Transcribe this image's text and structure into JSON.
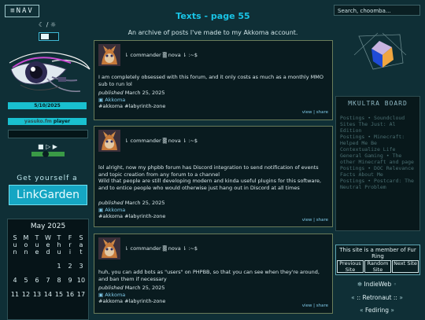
{
  "nav": {
    "label": "≡NAV"
  },
  "theme": {
    "moon": "☾",
    "sep": "/",
    "sun": "☼"
  },
  "sidebar": {
    "date": "5/10/2025",
    "radio_left": "yasuko.fm",
    "radio_right": "player",
    "controls": "■ ▷ ▶",
    "get_yourself": "Get yourself a",
    "linkgarden": "LinkGarden"
  },
  "calendar": {
    "title": "May 2025",
    "day_headers": [
      "S",
      "M",
      "T",
      "W",
      "T",
      "F",
      "S"
    ],
    "day_subs": [
      [
        "u",
        "n"
      ],
      [
        "o",
        "n"
      ],
      [
        "u",
        "e"
      ],
      [
        "e",
        "d"
      ],
      [
        "h",
        "u"
      ],
      [
        "r",
        "i"
      ],
      [
        "a",
        "t"
      ]
    ],
    "weeks": [
      [
        "",
        "",
        "",
        "",
        "1",
        "2",
        "3"
      ],
      [
        "4",
        "5",
        "6",
        "7",
        "8",
        "9",
        "10"
      ],
      [
        "11",
        "12",
        "13",
        "14",
        "15",
        "16",
        "17"
      ]
    ]
  },
  "page": {
    "title": "Texts - page 55",
    "subtitle": "I've made to my Akkoma account."
  },
  "posts": [
    {
      "header": "⇂ commander ▒ nova ⇂ :~$",
      "body": "I am completely obsessed with this forum, and it only costs as much as a monthly MMO sub to run lol",
      "published_label": "published",
      "date": "March 25, 2025",
      "platform": "Akkoma",
      "tags": "#akkoma #labyrinth-zone",
      "view": "view",
      "share": "share"
    },
    {
      "header": "⇂ commander ▒ nova ⇂ :~$",
      "body1": "lol alright, now my phpbb forum has Discord integration to send notification of events and topic creation from any forum to a channel",
      "body2": "Wild that people are still developing modern and kinda useful plugins for this software, and to entice people who would otherwise just hang out in Discord at all times",
      "published_label": "published",
      "date": "March 25, 2025",
      "platform": "Akkoma",
      "tags": "#akkoma #labyrinth-zone",
      "view": "view",
      "share": "share"
    },
    {
      "header": "⇂ commander ▒ nova ⇂ :~$",
      "body": "huh, you can add bots as \"users\" on PHPBB, so that you can see when they're around, and ban them if necessary",
      "published_label": "published",
      "date": "March 25, 2025",
      "platform": "Akkoma",
      "tags": "#akkoma #labyrinth-zone",
      "view": "view",
      "share": "share"
    }
  ],
  "search": {
    "placeholder": "Search, choomba..."
  },
  "mkultra": {
    "title": "MKULTRA BOARD",
    "items": [
      "Postings • Soundcloud Sites The Just: Al Edition",
      "Postings • Minecraft: Helped Me Be Contextualize Life",
      "General Gaming • The other Minecraft and page",
      "Postings • DOC Relevance Facts About Me",
      "Postings • Postcard: The Neutral Problem"
    ]
  },
  "fur_ring": {
    "text": "This site is a member of Fur Ring",
    "prev": "Previous Site",
    "random": "Random Site",
    "next": "Next Site"
  },
  "webrings": {
    "indieweb": "IndieWeb",
    "retronaut": ":: Retronaut ::",
    "fediring": "Fediring"
  },
  "colors": {
    "accent": "#19c4e6",
    "bg": "#0f2f36",
    "post_border": "#6a7c5a"
  }
}
